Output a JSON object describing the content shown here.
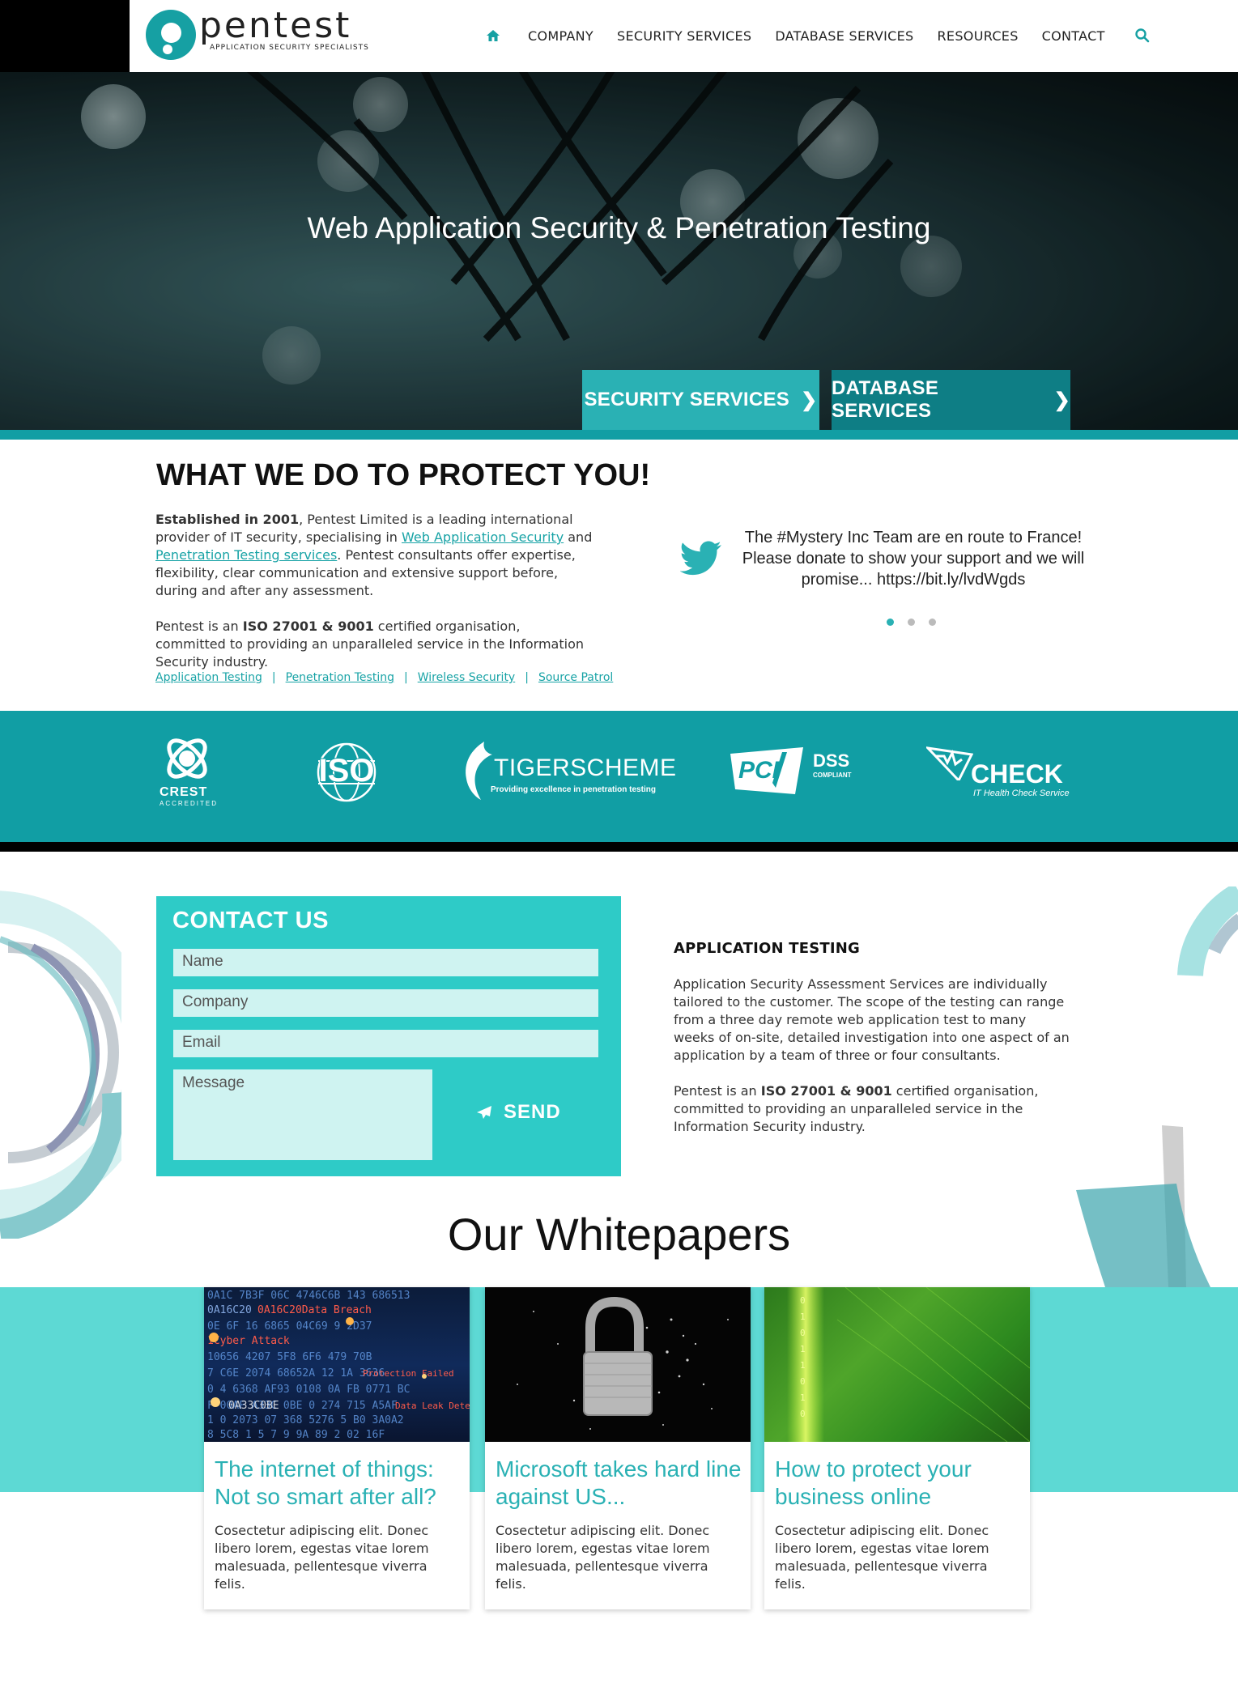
{
  "header": {
    "logo_text": "pentest",
    "logo_tagline": "APPLICATION SECURITY SPECIALISTS",
    "nav": [
      "COMPANY",
      "SECURITY SERVICES",
      "DATABASE SERVICES",
      "RESOURCES",
      "CONTACT"
    ],
    "icons": [
      "home-icon",
      "search-icon"
    ]
  },
  "hero": {
    "title": "Web Application Security & Penetration Testing",
    "buttons": [
      "SECURITY SERVICES",
      "DATABASE SERVICES"
    ]
  },
  "what_we_do": {
    "title_bold": "WHAT WE DO",
    "title_rest": " TO PROTECT YOU!",
    "p1_bold": "Established in 2001",
    "p1_a": ", Pentest Limited is a leading international provider of IT security, specialising in ",
    "p1_link1": "Web Application Security",
    "p1_b": " and ",
    "p1_link2": "Penetration Testing services",
    "p1_c": ". Pentest consultants offer expertise, flexibility, clear communication and extensive support before, during and after any assessment.",
    "p2_a": "Pentest is an ",
    "p2_bold": "ISO 27001 & 9001",
    "p2_b": " certified organisation, committed to providing an unparalleled service in the Information Security industry.",
    "links": [
      "Application Testing",
      "Penetration Testing",
      "Wireless Security",
      "Source Patrol"
    ],
    "link_separator": "|"
  },
  "tweet": {
    "text": "The #Mystery Inc Team are en route to France! Please donate to show your support and we will promise... https://bit.ly/lvdWgds",
    "active_dot": 0,
    "dot_count": 3
  },
  "accreditations": {
    "crest": "CREST",
    "crest_sub": "ACCREDITED",
    "iso": "ISO",
    "tigerscheme": "TIGERSCHEME",
    "tigerscheme_sub": "Providing excellence in penetration testing",
    "pci": "PCI",
    "pci_dss": "DSS",
    "pci_sub": "COMPLIANT",
    "check": "CHECK",
    "check_sub": "IT Health Check Service"
  },
  "contact": {
    "title": "CONTACT US",
    "name_placeholder": "Name",
    "company_placeholder": "Company",
    "email_placeholder": "Email",
    "message_placeholder": "Message",
    "send_label": "SEND"
  },
  "application_testing": {
    "title": "APPLICATION TESTING",
    "p1": "Application Security Assessment Services are individually tailored to the customer. The scope of the testing can range from a three day remote web application test to many weeks of on-site, detailed investigation into one aspect of an application by a team of three or four consultants.",
    "p2_a": "Pentest is an ",
    "p2_bold": "ISO 27001 & 9001",
    "p2_b": " certified organisation, committed to providing an unparalleled service in the Information Security industry."
  },
  "whitepapers": {
    "title": "Our Whitepapers",
    "cards": [
      {
        "title": "The internet of things: Not so smart after all?",
        "text": "Cosectetur adipiscing elit. Donec libero lorem, egestas vitae lorem malesuada, pellentesque viverra felis."
      },
      {
        "title": "Microsoft takes hard line against US...",
        "text": "Cosectetur adipiscing elit. Donec libero lorem, egestas vitae lorem malesuada, pellentesque viverra felis."
      },
      {
        "title": "How to protect your business online",
        "text": "Cosectetur adipiscing elit. Donec libero lorem, egestas vitae lorem malesuada, pellentesque viverra felis."
      }
    ],
    "card1_image_text": [
      "0A16C20Data Breach",
      "1Cyber Attack",
      "Protection Failed",
      "Data Leak Detected",
      "0A33C0BE"
    ]
  },
  "colors": {
    "brand_teal": "#119ea4",
    "light_teal": "#2ecbc7",
    "band_teal": "#5dd9d4",
    "dark_teal": "#0e7e85"
  }
}
